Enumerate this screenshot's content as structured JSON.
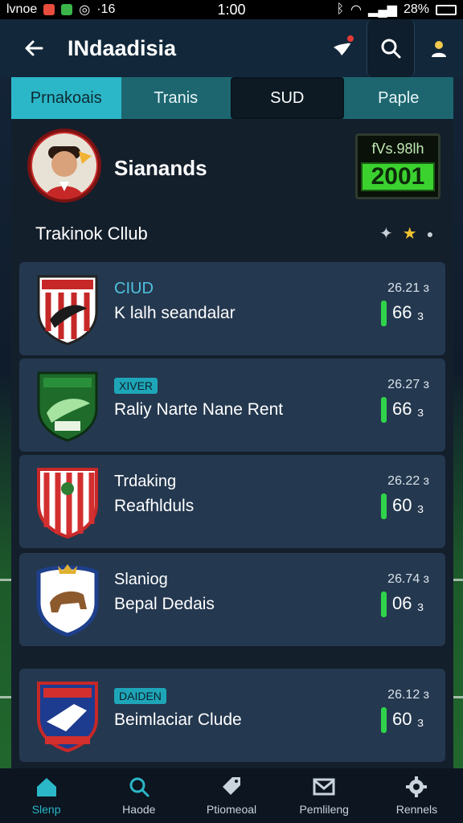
{
  "status_bar": {
    "left_text": "lvnoe",
    "network": "·16",
    "time": "1:00",
    "battery": "28%"
  },
  "header": {
    "title": "INdaadisia"
  },
  "tabs": [
    {
      "label": "Prnakoais",
      "state": "active"
    },
    {
      "label": "Tranis",
      "state": "normal"
    },
    {
      "label": "SUD",
      "state": "dark"
    },
    {
      "label": "Paple",
      "state": "normal"
    }
  ],
  "profile": {
    "name": "Sianands"
  },
  "scoreboard": {
    "top": "fVs.98lh",
    "main": "2001"
  },
  "section": {
    "title": "Trakinok Cllub"
  },
  "clubs": [
    {
      "line1": "CIUD",
      "line2": "K lalh seandalar",
      "time": "26.21 ɜ",
      "score": "66 ₃",
      "tag": ""
    },
    {
      "line1": "",
      "line2": "Raliy Narte Nane Rent",
      "time": "26.27 ɜ",
      "score": "66 ₃",
      "tag": "XIVER"
    },
    {
      "line1": "Trdaking",
      "line2": "Reafhlduls",
      "time": "26.22 ɜ",
      "score": "60 ₃",
      "tag": ""
    },
    {
      "line1": "Slaniog",
      "line2": "Bepal Dedais",
      "time": "26.74 ɜ",
      "score": "06 ₃",
      "tag": ""
    },
    {
      "line1": "",
      "line2": "Beimlaciar Clude",
      "time": "26.12 ɜ",
      "score": "60 ₃",
      "tag": "DAIDEN"
    }
  ],
  "bottom_nav": [
    {
      "label": "Slenp",
      "icon": "home-icon",
      "active": true
    },
    {
      "label": "Haode",
      "icon": "search-icon",
      "active": false
    },
    {
      "label": "Ptiomeoal",
      "icon": "tag-icon",
      "active": false
    },
    {
      "label": "Pemlileng",
      "icon": "mail-icon",
      "active": false
    },
    {
      "label": "Rennels",
      "icon": "gear-icon",
      "active": false
    }
  ],
  "colors": {
    "accent": "#2bb7c8",
    "panel": "#141f2c",
    "card": "#24384f",
    "score_green": "#3bd22f",
    "bar_green": "#2fd34a"
  }
}
